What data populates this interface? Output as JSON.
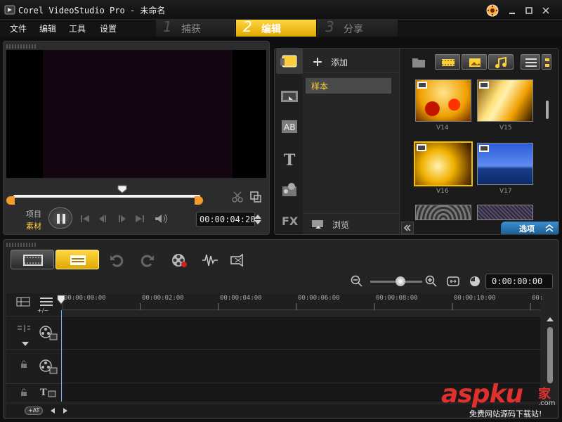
{
  "app": {
    "title": "Corel VideoStudio Pro - 未命名"
  },
  "menu": [
    "文件",
    "编辑",
    "工具",
    "设置"
  ],
  "steps": [
    {
      "num": "1",
      "label": "捕获"
    },
    {
      "num": "2",
      "label": "编辑"
    },
    {
      "num": "3",
      "label": "分享"
    }
  ],
  "player": {
    "mode_project": "项目",
    "mode_clip": "素材",
    "timecode": "00:00:04:20"
  },
  "library": {
    "add_label": "添加",
    "folder": "样本",
    "browse_label": "浏览",
    "options_label": "选项",
    "thumbs": [
      {
        "label": "V14"
      },
      {
        "label": "V15"
      },
      {
        "label": "V16"
      },
      {
        "label": "V17"
      }
    ]
  },
  "timeline": {
    "zoom_time": "0:00:00:00",
    "add_del": "+/−",
    "ruler": [
      "00:00:00:00",
      "00:00:02:00",
      "00:00:04:00",
      "00:00:06:00",
      "00:00:08:00",
      "00:00:10:00",
      "00:"
    ],
    "fit_label": "+AT"
  },
  "watermark": {
    "main": "aspku",
    "sub_tld": ".com",
    "chinese": "家",
    "tagline": "免费网站源码下载站!"
  },
  "colors": {
    "accent": "#f2c200",
    "blue": "#2f7fbf"
  }
}
